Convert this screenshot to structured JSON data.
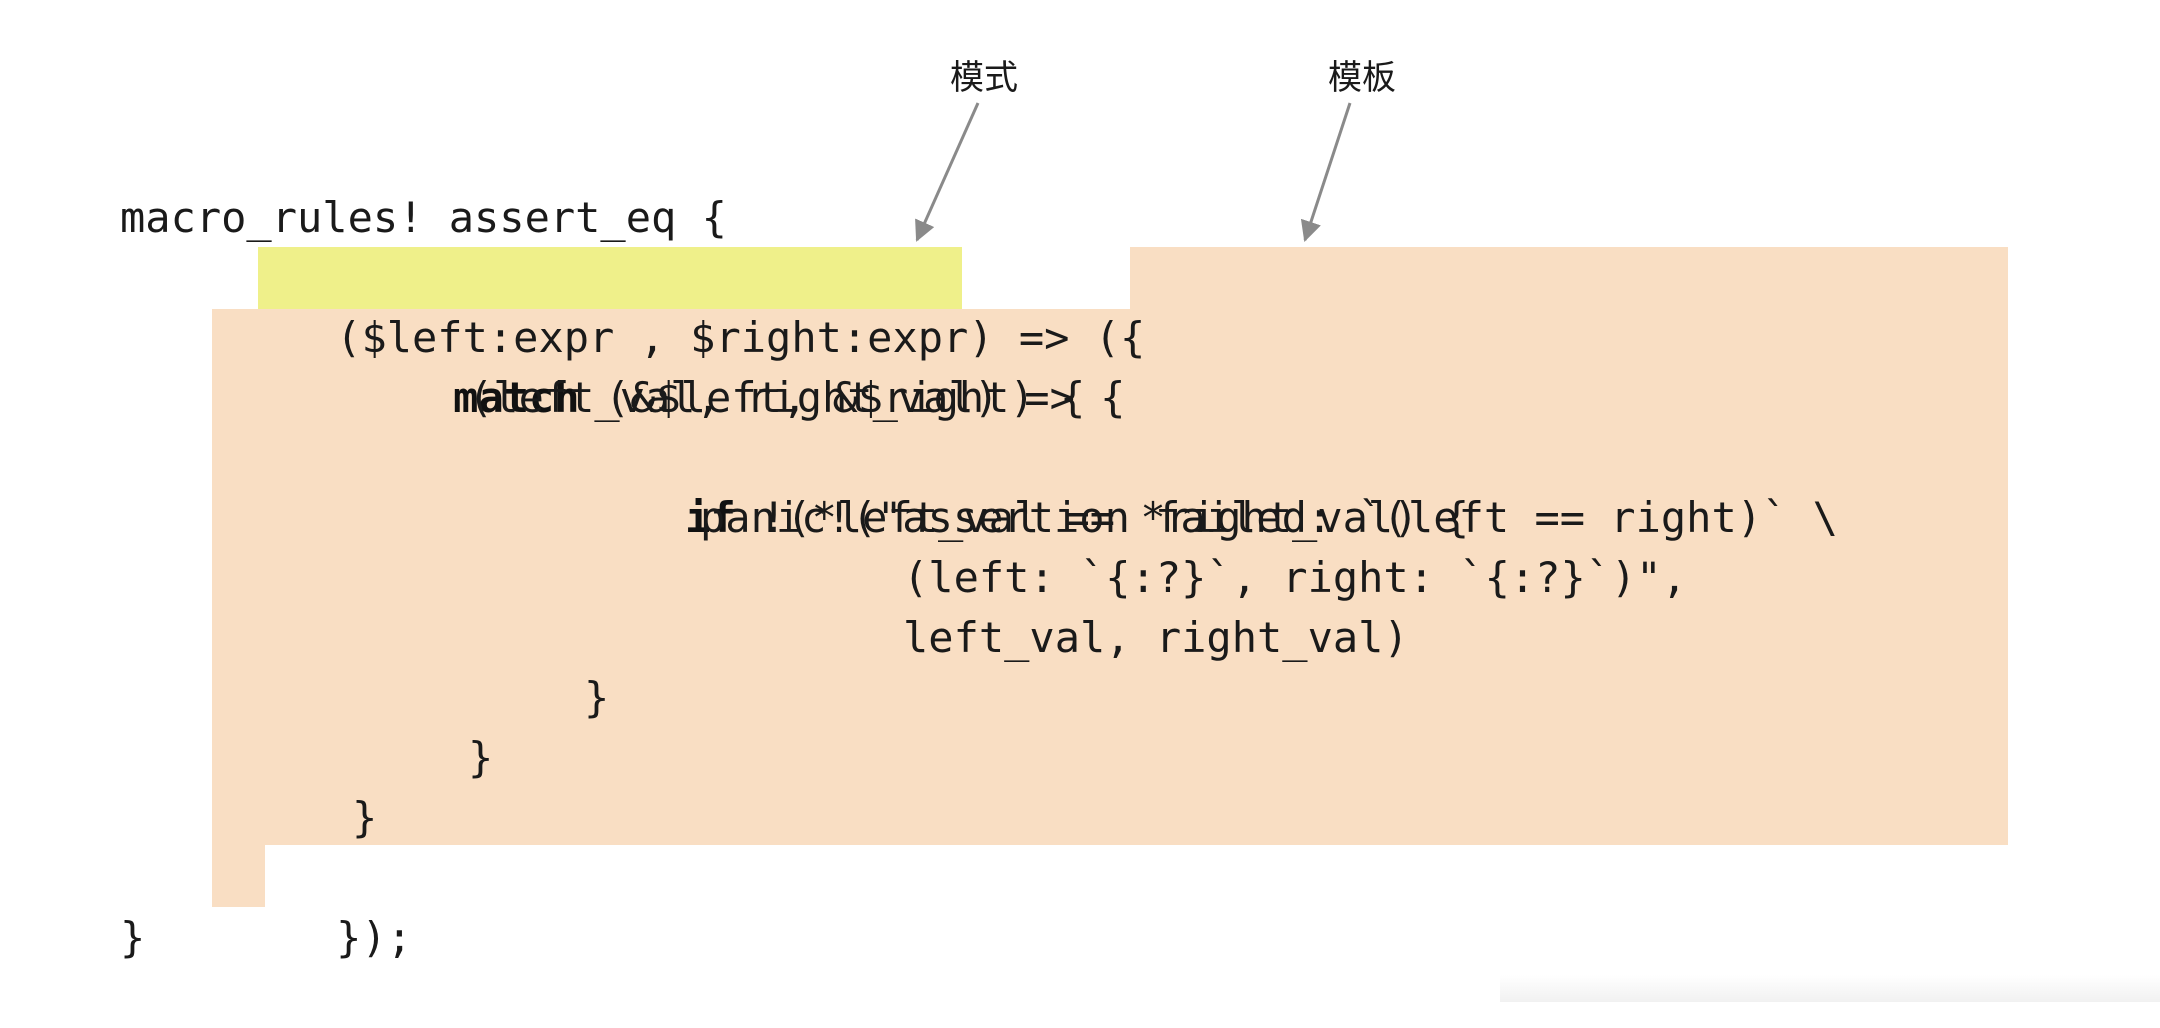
{
  "labels": {
    "pattern": "模式",
    "template": "模板"
  },
  "code": {
    "line1": "macro_rules! assert_eq {",
    "line2": {
      "open_paren": "(",
      "pattern": "$left:expr , $right:expr",
      "close_arrow": ") => (",
      "brace": "{"
    },
    "line3": {
      "kw": "match",
      "rest": " (&$left, &$right) {"
    },
    "line4": "(left_val, right_val) => {",
    "line5": {
      "kw": "if",
      "rest": " !(*left_val == *right_val) {"
    },
    "line6": "panic!(\"assertion failed: `(left == right)` \\",
    "line7": "(left: `{:?}`, right: `{:?}`)\",",
    "line8": "left_val, right_val)",
    "line9": "}",
    "line10": "}",
    "line11": "}",
    "line12": {
      "brace": "}",
      "tail": ");"
    },
    "line13": "}"
  },
  "colors": {
    "template_highlight": "#f9dec3",
    "pattern_highlight": "#eff08a",
    "arrow": "#8a8a8a",
    "text": "#1a1a1a"
  }
}
